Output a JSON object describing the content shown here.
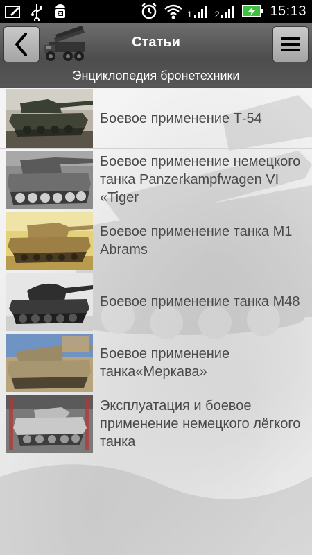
{
  "statusbar": {
    "left_icons": [
      "screen-edit-icon",
      "usb-icon",
      "android-debug-icon"
    ],
    "right_icons": [
      "alarm-icon",
      "wifi-icon",
      "signal-1-icon",
      "signal-2-icon",
      "battery-charging-icon"
    ],
    "signal_1_label": "1",
    "signal_2_label": "2",
    "time": "15:13"
  },
  "actionbar": {
    "back_icon": "chevron-left-icon",
    "logo_icon": "rocket-launcher-truck-icon",
    "title": "Статьи",
    "subtitle": "Энциклопедия бронетехники",
    "menu_icon": "hamburger-menu-icon",
    "accent_color": "#d61a1a"
  },
  "articles": [
    {
      "title": "Боевое применение Т-54",
      "thumb": "t54-tank-photo"
    },
    {
      "title": "Боевое применение немецкого танка Panzerkampfwagen VI «Tiger",
      "thumb": "tiger-tank-photo"
    },
    {
      "title": "Боевое применение танка M1 Abrams",
      "thumb": "abrams-tank-photo"
    },
    {
      "title": "Боевое применение танка M48",
      "thumb": "m48-tank-photo"
    },
    {
      "title": "Боевое применение танка«Меркава»",
      "thumb": "merkava-tank-photo"
    },
    {
      "title": "Эксплуатация и боевое применение немецкого лёгкого танка",
      "thumb": "panzer-light-tank-photo"
    }
  ]
}
